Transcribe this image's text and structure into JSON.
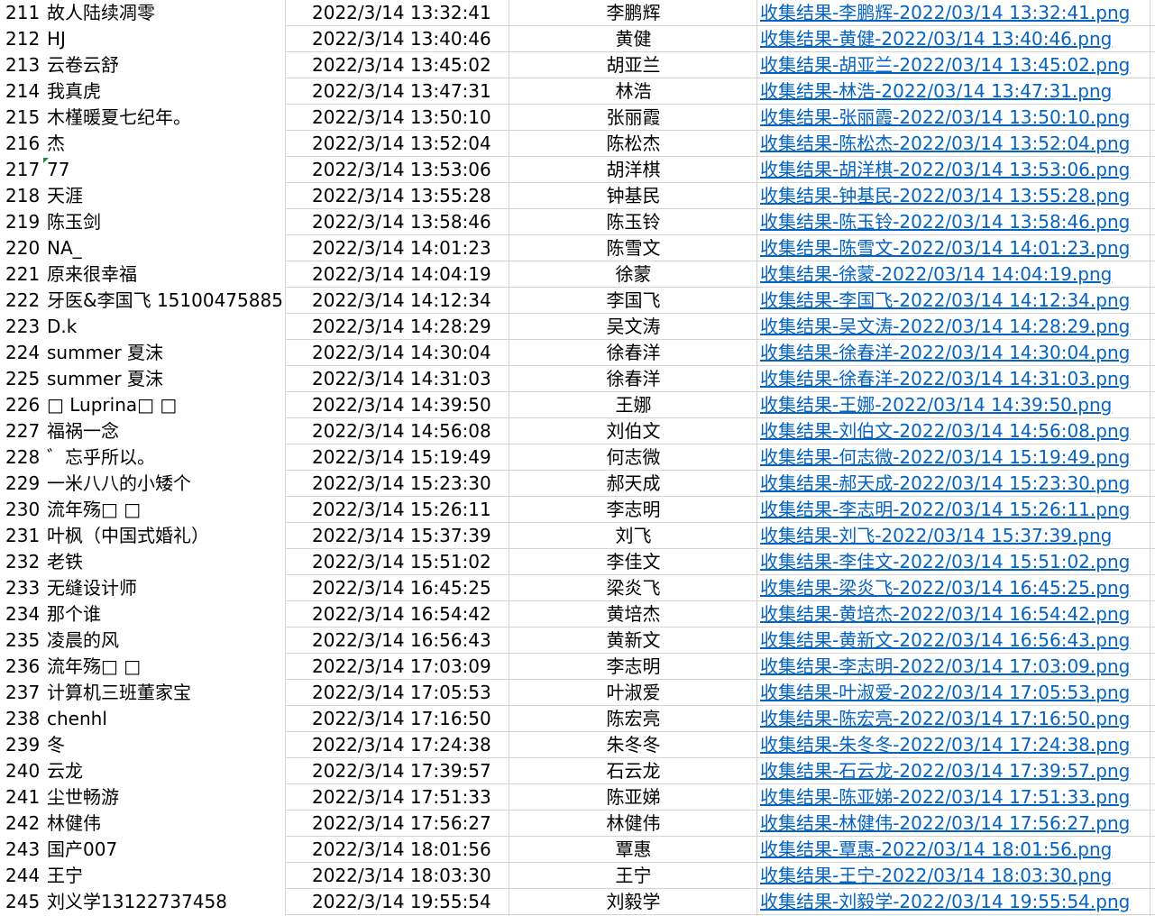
{
  "sheet": {
    "link_color": "#0563c1",
    "grid_color": "#d4d4d4",
    "comment_marker_color": "#1e8a3c",
    "comment_marker_row": "217",
    "rows": [
      {
        "num": "211",
        "name": "故人陆续凋零",
        "time": "2022/3/14 13:32:41",
        "person": "李鹏辉",
        "link": "收集结果-李鹏辉-2022/03/14 13:32:41.png"
      },
      {
        "num": "212",
        "name": "HJ",
        "time": "2022/3/14 13:40:46",
        "person": "黄健",
        "link": "收集结果-黄健-2022/03/14 13:40:46.png"
      },
      {
        "num": "213",
        "name": "云卷云舒",
        "time": "2022/3/14 13:45:02",
        "person": "胡亚兰",
        "link": "收集结果-胡亚兰-2022/03/14 13:45:02.png"
      },
      {
        "num": "214",
        "name": "我真虎",
        "time": "2022/3/14 13:47:31",
        "person": "林浩",
        "link": "收集结果-林浩-2022/03/14 13:47:31.png"
      },
      {
        "num": "215",
        "name": "木槿暖夏七纪年。",
        "time": "2022/3/14 13:50:10",
        "person": "张丽霞",
        "link": "收集结果-张丽霞-2022/03/14 13:50:10.png"
      },
      {
        "num": "216",
        "name": "杰",
        "time": "2022/3/14 13:52:04",
        "person": "陈松杰",
        "link": "收集结果-陈松杰-2022/03/14 13:52:04.png"
      },
      {
        "num": "217",
        "name": "77",
        "time": "2022/3/14 13:53:06",
        "person": "胡洋棋",
        "link": "收集结果-胡洋棋-2022/03/14 13:53:06.png"
      },
      {
        "num": "218",
        "name": "天涯",
        "time": "2022/3/14 13:55:28",
        "person": "钟基民",
        "link": "收集结果-钟基民-2022/03/14 13:55:28.png"
      },
      {
        "num": "219",
        "name": "陈玉剑",
        "time": "2022/3/14 13:58:46",
        "person": "陈玉铃",
        "link": "收集结果-陈玉铃-2022/03/14 13:58:46.png"
      },
      {
        "num": "220",
        "name": "NA_",
        "time": "2022/3/14 14:01:23",
        "person": "陈雪文",
        "link": "收集结果-陈雪文-2022/03/14 14:01:23.png"
      },
      {
        "num": "221",
        "name": "原来很幸福",
        "time": "2022/3/14 14:04:19",
        "person": "徐蒙",
        "link": "收集结果-徐蒙-2022/03/14 14:04:19.png"
      },
      {
        "num": "222",
        "name": "牙医&李国飞 15100475885",
        "time": "2022/3/14 14:12:34",
        "person": "李国飞",
        "link": "收集结果-李国飞-2022/03/14 14:12:34.png"
      },
      {
        "num": "223",
        "name": "D.k",
        "time": "2022/3/14 14:28:29",
        "person": "吴文涛",
        "link": "收集结果-吴文涛-2022/03/14 14:28:29.png"
      },
      {
        "num": "224",
        "name": "summer 夏沫",
        "time": "2022/3/14 14:30:04",
        "person": "徐春洋",
        "link": "收集结果-徐春洋-2022/03/14 14:30:04.png"
      },
      {
        "num": "225",
        "name": "summer 夏沫",
        "time": "2022/3/14 14:31:03",
        "person": "徐春洋",
        "link": "收集结果-徐春洋-2022/03/14 14:31:03.png"
      },
      {
        "num": "226",
        "name": "□ Luprina□ □",
        "time": "2022/3/14 14:39:50",
        "person": "王娜",
        "link": "收集结果-王娜-2022/03/14 14:39:50.png"
      },
      {
        "num": "227",
        "name": "福祸一念",
        "time": "2022/3/14 14:56:08",
        "person": "刘伯文",
        "link": "收集结果-刘伯文-2022/03/14 14:56:08.png"
      },
      {
        "num": "228",
        "name": "゛忘乎所以。",
        "time": "2022/3/14 15:19:49",
        "person": "何志微",
        "link": "收集结果-何志微-2022/03/14 15:19:49.png"
      },
      {
        "num": "229",
        "name": "一米八八的小矮个",
        "time": "2022/3/14 15:23:30",
        "person": "郝天成",
        "link": "收集结果-郝天成-2022/03/14 15:23:30.png"
      },
      {
        "num": "230",
        "name": "流年殇□ □",
        "time": "2022/3/14 15:26:11",
        "person": "李志明",
        "link": "收集结果-李志明-2022/03/14 15:26:11.png"
      },
      {
        "num": "231",
        "name": "叶枫（中国式婚礼）",
        "time": "2022/3/14 15:37:39",
        "person": "刘飞",
        "link": "收集结果-刘飞-2022/03/14 15:37:39.png"
      },
      {
        "num": "232",
        "name": "老铁",
        "time": "2022/3/14 15:51:02",
        "person": "李佳文",
        "link": "收集结果-李佳文-2022/03/14 15:51:02.png"
      },
      {
        "num": "233",
        "name": "无缝设计师",
        "time": "2022/3/14 16:45:25",
        "person": "梁炎飞",
        "link": "收集结果-梁炎飞-2022/03/14 16:45:25.png"
      },
      {
        "num": "234",
        "name": "那个谁",
        "time": "2022/3/14 16:54:42",
        "person": "黄培杰",
        "link": "收集结果-黄培杰-2022/03/14 16:54:42.png"
      },
      {
        "num": "235",
        "name": "凌晨的风",
        "time": "2022/3/14 16:56:43",
        "person": "黄新文",
        "link": "收集结果-黄新文-2022/03/14 16:56:43.png"
      },
      {
        "num": "236",
        "name": "流年殇□ □",
        "time": "2022/3/14 17:03:09",
        "person": "李志明",
        "link": "收集结果-李志明-2022/03/14 17:03:09.png"
      },
      {
        "num": "237",
        "name": "计算机三班董家宝",
        "time": "2022/3/14 17:05:53",
        "person": "叶淑爱",
        "link": "收集结果-叶淑爱-2022/03/14 17:05:53.png"
      },
      {
        "num": "238",
        "name": "chenhl",
        "time": "2022/3/14 17:16:50",
        "person": "陈宏亮",
        "link": "收集结果-陈宏亮-2022/03/14 17:16:50.png"
      },
      {
        "num": "239",
        "name": "冬",
        "time": "2022/3/14 17:24:38",
        "person": "朱冬冬",
        "link": "收集结果-朱冬冬-2022/03/14 17:24:38.png"
      },
      {
        "num": "240",
        "name": "云龙",
        "time": "2022/3/14 17:39:57",
        "person": "石云龙",
        "link": "收集结果-石云龙-2022/03/14 17:39:57.png"
      },
      {
        "num": "241",
        "name": "尘世畅游",
        "time": "2022/3/14 17:51:33",
        "person": "陈亚娣",
        "link": "收集结果-陈亚娣-2022/03/14 17:51:33.png"
      },
      {
        "num": "242",
        "name": "林健伟",
        "time": "2022/3/14 17:56:27",
        "person": "林健伟",
        "link": "收集结果-林健伟-2022/03/14 17:56:27.png"
      },
      {
        "num": "243",
        "name": "国产007",
        "time": "2022/3/14 18:01:56",
        "person": "覃惠",
        "link": "收集结果-覃惠-2022/03/14 18:01:56.png"
      },
      {
        "num": "244",
        "name": "王宁",
        "time": "2022/3/14 18:03:30",
        "person": "王宁",
        "link": "收集结果-王宁-2022/03/14 18:03:30.png"
      },
      {
        "num": "245",
        "name": "刘义学13122737458",
        "time": "2022/3/14 19:55:54",
        "person": "刘毅学",
        "link": "收集结果-刘毅学-2022/03/14 19:55:54.png"
      }
    ]
  }
}
